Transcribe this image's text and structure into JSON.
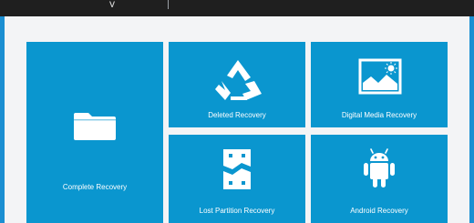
{
  "window": {
    "title_fragment": "y"
  },
  "tiles": [
    {
      "name": "complete-recovery",
      "label": "Complete Recovery",
      "icon": "folder-icon"
    },
    {
      "name": "deleted-recovery",
      "label": "Deleted Recovery",
      "icon": "recycle-icon"
    },
    {
      "name": "digital-media-recovery",
      "label": "Digital Media Recovery",
      "icon": "image-icon"
    },
    {
      "name": "lost-partition-recovery",
      "label": "Lost Partition Recovery",
      "icon": "broken-drive-icon"
    },
    {
      "name": "android-recovery",
      "label": "Android Recovery",
      "icon": "android-icon"
    }
  ],
  "colors": {
    "tile": "#0a96cf",
    "content_background": "#f3f4f6",
    "title_bar": "#1f1f1f",
    "frame": "#1b8fd2"
  }
}
